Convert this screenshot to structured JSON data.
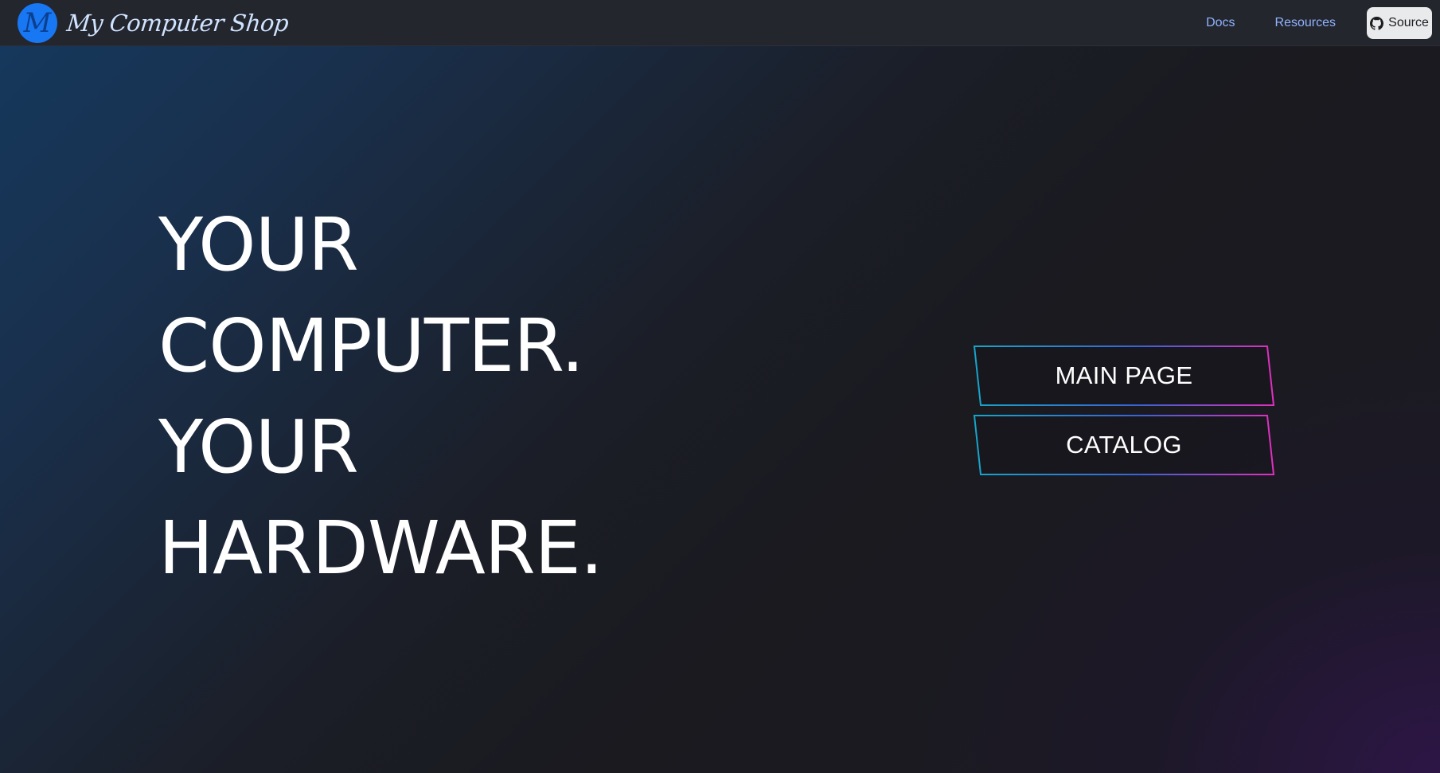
{
  "brand": {
    "logo_letter": "M",
    "name": "My Computer Shop"
  },
  "nav": {
    "links": [
      {
        "label": "Docs"
      },
      {
        "label": "Resources"
      }
    ],
    "source_button": {
      "label": "Source",
      "icon": "github-icon"
    }
  },
  "hero": {
    "lines": [
      "YOUR",
      "COMPUTER.",
      "YOUR",
      "HARDWARE."
    ]
  },
  "cta": {
    "main_page_label": "MAIN PAGE",
    "catalog_label": "CATALOG"
  },
  "colors": {
    "nav_bg": "#24262e",
    "logo_blue": "#1877f2",
    "nav_link": "#8fb3ff",
    "cta_border_start": "#17a5c9",
    "cta_border_end": "#e22fbf"
  }
}
